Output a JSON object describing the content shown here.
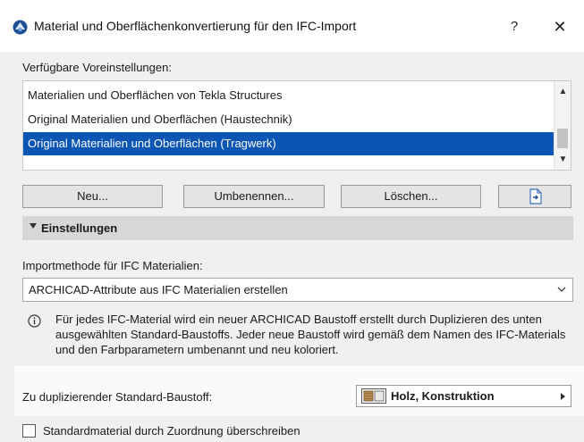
{
  "window": {
    "title": "Material und Oberflächenkonvertierung für den IFC-Import",
    "help_label": "?",
    "close_label": "✕"
  },
  "presets": {
    "label": "Verfügbare Voreinstellungen:",
    "items": [
      "Materialien und Oberflächen von Tekla Structures",
      "Original Materialien und Oberflächen (Haustechnik)",
      "Original Materialien und Oberflächen (Tragwerk)"
    ],
    "selected_index": 2
  },
  "buttons": {
    "new": "Neu...",
    "rename": "Umbenennen...",
    "delete": "Löschen..."
  },
  "settings": {
    "header": "Einstellungen",
    "import_method_label": "Importmethode für IFC Materialien:",
    "import_method_value": "ARCHICAD-Attribute aus IFC Materialien erstellen",
    "info_text": "Für jedes IFC-Material wird ein neuer ARCHICAD Baustoff erstellt durch Duplizieren des unten ausgewählten Standard-Baustoffs. Jeder neue Baustoff wird gemäß dem Namen des IFC-Materials und den Farbparametern umbenannt und neu koloriert.",
    "standard_material_label": "Zu duplizierender Standard-Baustoff:",
    "standard_material_value": "Holz, Konstruktion",
    "override_checkbox_label": "Standardmaterial durch Zuordnung überschreiben",
    "override_checked": false
  },
  "colors": {
    "selection": "#0b55b5",
    "section_header": "#d7d7d7",
    "wood_swatch": "#b58a52"
  }
}
